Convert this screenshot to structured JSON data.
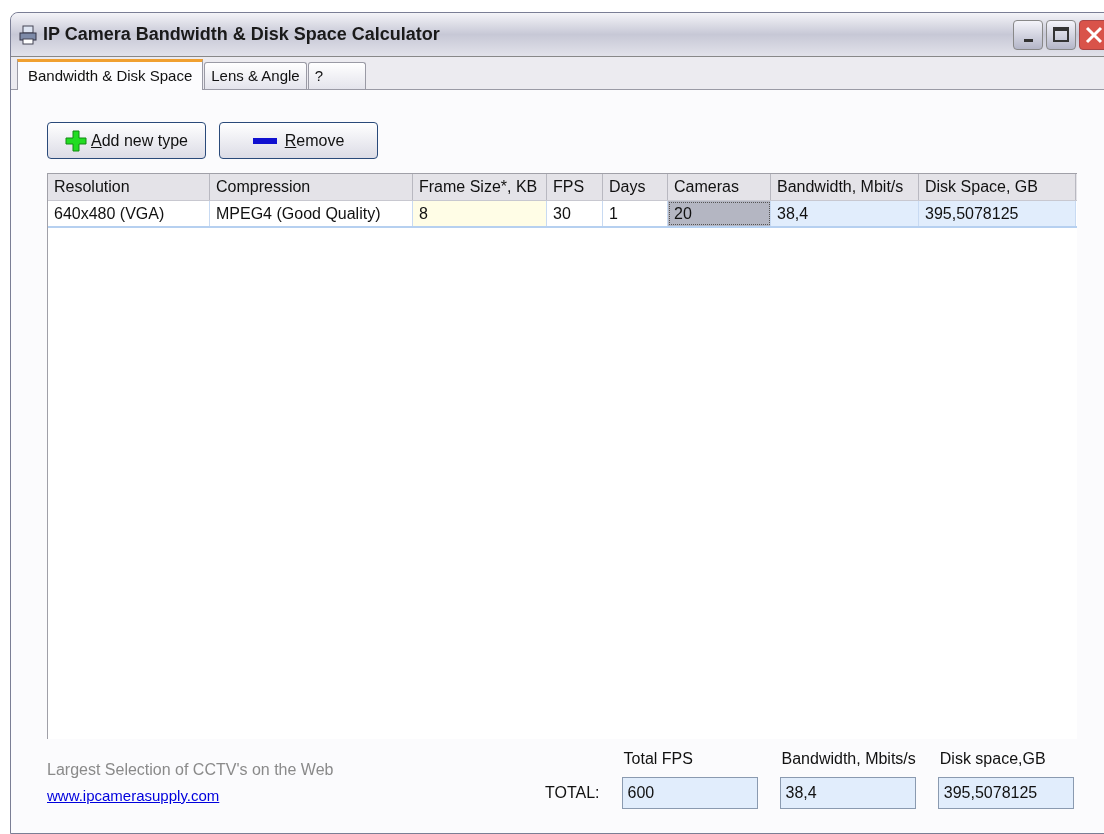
{
  "window": {
    "title": "IP Camera Bandwidth & Disk Space Calculator"
  },
  "tabs": [
    {
      "label": "Bandwidth & Disk Space",
      "selected": true
    },
    {
      "label": "Lens & Angle",
      "selected": false
    },
    {
      "label": "?",
      "selected": false
    }
  ],
  "toolbar": [
    {
      "kind": "add",
      "label": "Add new type"
    },
    {
      "kind": "remove",
      "label": "Remove"
    }
  ],
  "table": {
    "columns": [
      "Resolution",
      "Compression",
      "Frame Size*, KB",
      "FPS",
      "Days",
      "Cameras",
      "Bandwidth, Mbit/s",
      "Disk Space, GB"
    ],
    "rows": [
      {
        "selected": true,
        "cells": [
          {
            "value": "640x480 (VGA)",
            "kind": "plain"
          },
          {
            "value": "MPEG4 (Good Quality)",
            "kind": "plain"
          },
          {
            "value": "8",
            "kind": "highlight"
          },
          {
            "value": "30",
            "kind": "plain"
          },
          {
            "value": "1",
            "kind": "plain"
          },
          {
            "value": "20",
            "kind": "focused"
          },
          {
            "value": "38,4",
            "kind": "computed"
          },
          {
            "value": "395,5078125",
            "kind": "computed"
          }
        ]
      }
    ]
  },
  "footer": {
    "slogan": "Largest Selection of CCTV's on the Web",
    "link": "www.ipcamerasupply.com",
    "total_label": "TOTAL:",
    "totals": [
      {
        "label": "Total FPS",
        "value": "600"
      },
      {
        "label": "Bandwidth, Mbits/s",
        "value": "38,4"
      },
      {
        "label": "Disk space,GB",
        "value": "395,5078125"
      }
    ]
  }
}
